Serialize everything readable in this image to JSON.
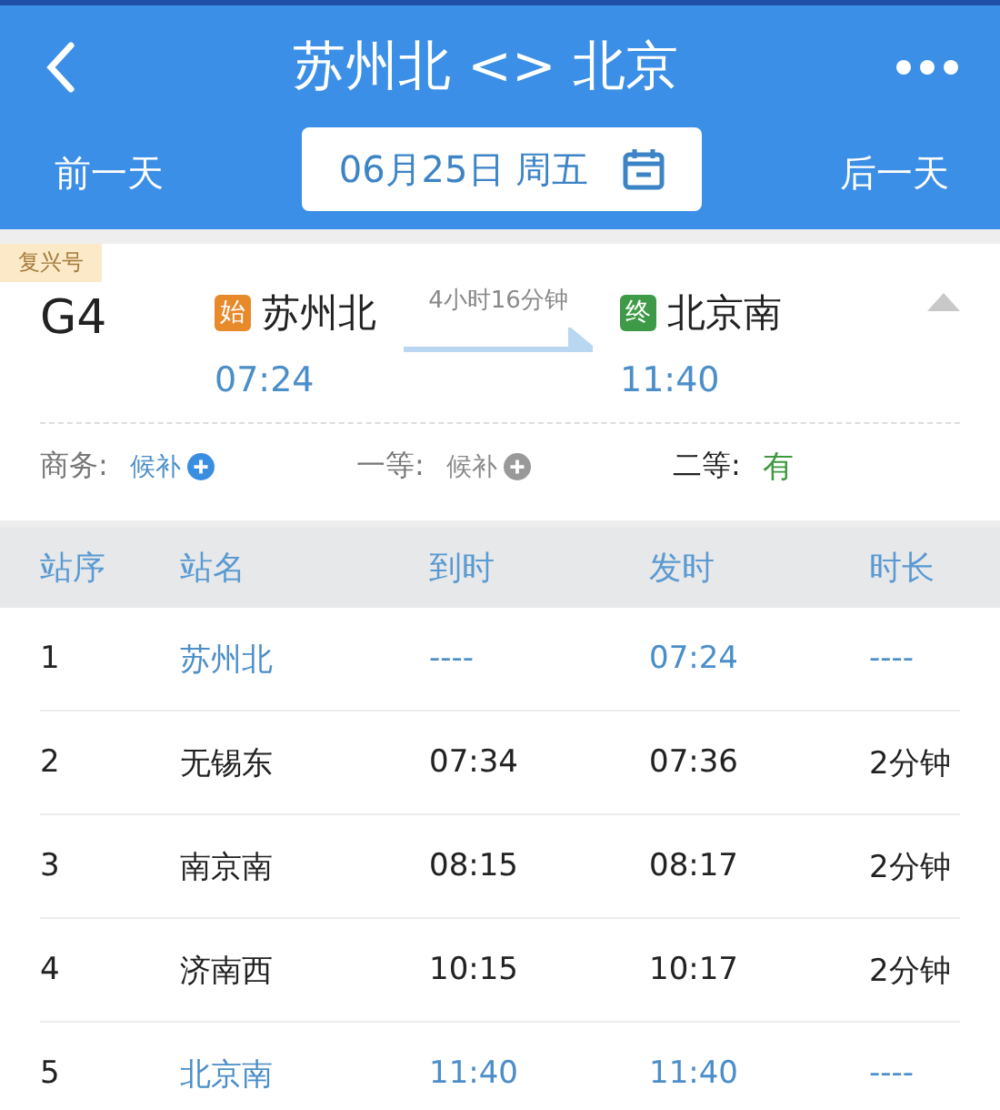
{
  "header": {
    "title": "苏州北 <> 北京",
    "prev_day": "前一天",
    "date": "06月25日 周五",
    "next_day": "后一天"
  },
  "train": {
    "badge": "复兴号",
    "number": "G4",
    "duration": "4小时16分钟",
    "from": {
      "mark": "始",
      "station": "苏州北",
      "time": "07:24"
    },
    "to": {
      "mark": "终",
      "station": "北京南",
      "time": "11:40"
    },
    "expanded": true,
    "seats": [
      {
        "class": "商务:",
        "status": "候补",
        "kind": "waitlist"
      },
      {
        "class": "一等:",
        "status": "候补",
        "kind": "waitlist_off"
      },
      {
        "class": "二等:",
        "status": "有",
        "kind": "available"
      }
    ]
  },
  "table": {
    "columns": [
      "站序",
      "站名",
      "到时",
      "发时",
      "时长"
    ],
    "rows": [
      {
        "no": "1",
        "station": "苏州北",
        "arrive": "----",
        "depart": "07:24",
        "stop": "----",
        "highlighted": true
      },
      {
        "no": "2",
        "station": "无锡东",
        "arrive": "07:34",
        "depart": "07:36",
        "stop": "2分钟",
        "highlighted": false
      },
      {
        "no": "3",
        "station": "南京南",
        "arrive": "08:15",
        "depart": "08:17",
        "stop": "2分钟",
        "highlighted": false
      },
      {
        "no": "4",
        "station": "济南西",
        "arrive": "10:15",
        "depart": "10:17",
        "stop": "2分钟",
        "highlighted": false
      },
      {
        "no": "5",
        "station": "北京南",
        "arrive": "11:40",
        "depart": "11:40",
        "stop": "----",
        "highlighted": true
      }
    ]
  }
}
